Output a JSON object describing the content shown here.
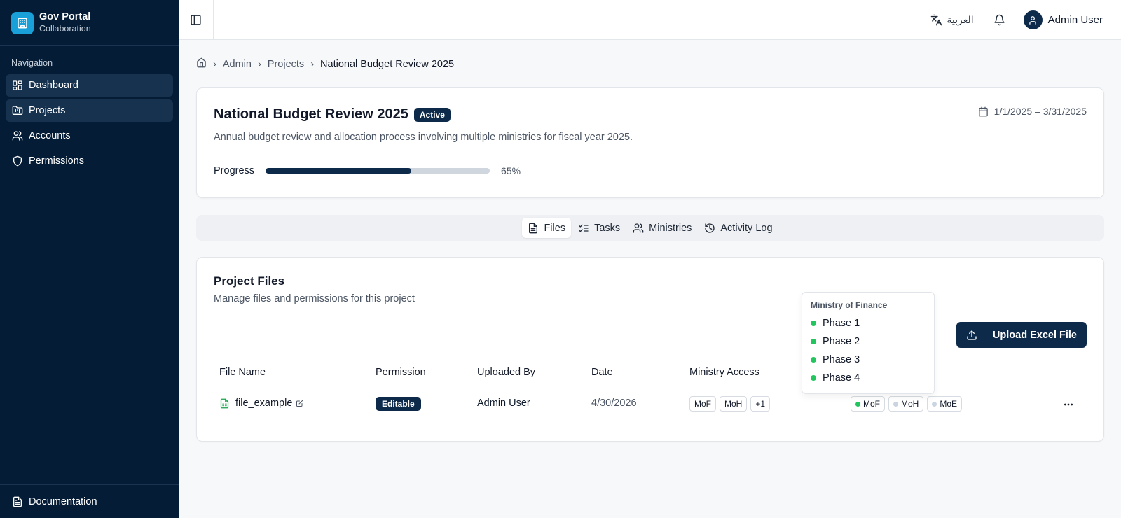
{
  "brand": {
    "name": "Gov Portal",
    "subtitle": "Collaboration"
  },
  "sidebar": {
    "section_title": "Navigation",
    "items": [
      {
        "label": "Dashboard",
        "icon": "dashboard-icon"
      },
      {
        "label": "Projects",
        "icon": "folder-kanban-icon"
      },
      {
        "label": "Accounts",
        "icon": "users-icon"
      },
      {
        "label": "Permissions",
        "icon": "shield-icon"
      }
    ],
    "footer_item": {
      "label": "Documentation",
      "icon": "document-icon"
    }
  },
  "topbar": {
    "language_label": "العربية",
    "user_name": "Admin User"
  },
  "breadcrumb": {
    "items": [
      "Admin",
      "Projects"
    ],
    "current": "National Budget Review 2025"
  },
  "project": {
    "title": "National Budget Review 2025",
    "status": "Active",
    "description": "Annual budget review and allocation process involving multiple ministries for fiscal year 2025.",
    "date_range": "1/1/2025 – 3/31/2025",
    "progress_label": "Progress",
    "progress_value": 65,
    "progress_text": "65%"
  },
  "tabs": [
    {
      "label": "Files",
      "icon": "file-icon",
      "active": true
    },
    {
      "label": "Tasks",
      "icon": "list-checks-icon",
      "active": false
    },
    {
      "label": "Ministries",
      "icon": "users-icon",
      "active": false
    },
    {
      "label": "Activity Log",
      "icon": "history-icon",
      "active": false
    }
  ],
  "files": {
    "title": "Project Files",
    "subtitle": "Manage files and permissions for this project",
    "upload_label": "Upload Excel File",
    "columns": [
      "File Name",
      "Permission",
      "Uploaded By",
      "Date",
      "Ministry Access"
    ],
    "rows": [
      {
        "name": "file_example",
        "permission": "Editable",
        "uploaded_by": "Admin User",
        "date": "4/30/2026",
        "ministry_access": [
          "MoF",
          "MoH",
          "+1"
        ],
        "status_chips": [
          {
            "label": "MoF",
            "color": "#22c55e"
          },
          {
            "label": "MoH",
            "color": "#cbd5e1"
          },
          {
            "label": "MoE",
            "color": "#cbd5e1"
          }
        ]
      }
    ]
  },
  "tooltip": {
    "title": "Ministry of Finance",
    "phases": [
      "Phase 1",
      "Phase 2",
      "Phase 3",
      "Phase 4"
    ],
    "phase_color": "#22c55e"
  },
  "colors": {
    "sidebar_bg": "#041c36",
    "primary": "#0d2a4b",
    "brand_accent": "#1aa0d8",
    "success": "#22c55e"
  }
}
